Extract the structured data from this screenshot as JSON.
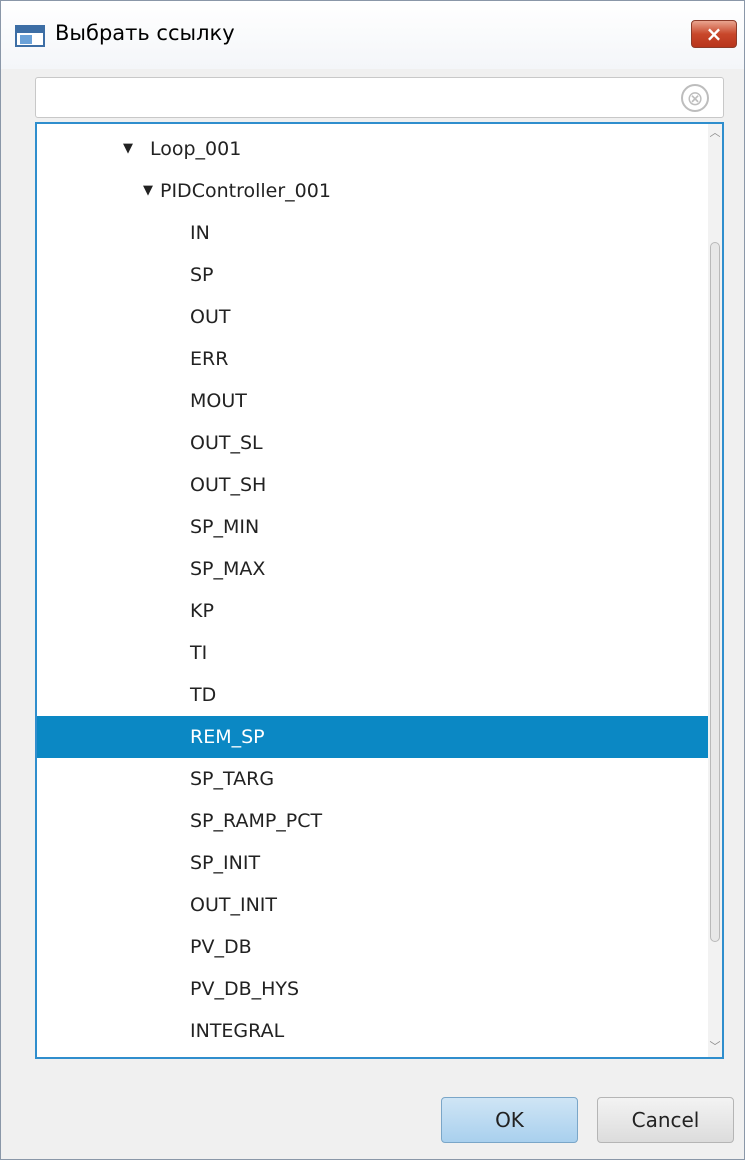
{
  "window": {
    "title": "Выбрать ссылку",
    "close_label": "×"
  },
  "search": {
    "value": "",
    "placeholder": "",
    "clear_icon": "⊗"
  },
  "tree": {
    "loop": {
      "label": "Loop_001",
      "expanded": true
    },
    "controller": {
      "label": "PIDController_001",
      "expanded": true
    },
    "items": [
      {
        "label": "IN"
      },
      {
        "label": "SP"
      },
      {
        "label": "OUT"
      },
      {
        "label": "ERR"
      },
      {
        "label": "MOUT"
      },
      {
        "label": "OUT_SL"
      },
      {
        "label": "OUT_SH"
      },
      {
        "label": "SP_MIN"
      },
      {
        "label": "SP_MAX"
      },
      {
        "label": "KP"
      },
      {
        "label": "TI"
      },
      {
        "label": "TD"
      },
      {
        "label": "REM_SP",
        "selected": true
      },
      {
        "label": "SP_TARG"
      },
      {
        "label": "SP_RAMP_PCT"
      },
      {
        "label": "SP_INIT"
      },
      {
        "label": "OUT_INIT"
      },
      {
        "label": "PV_DB"
      },
      {
        "label": "PV_DB_HYS"
      },
      {
        "label": "INTEGRAL"
      }
    ]
  },
  "buttons": {
    "ok_label": "OK",
    "cancel_label": "Cancel"
  },
  "colors": {
    "selection": "#0b88c4",
    "tree_border": "#2f8ecd",
    "close_button": "#c8472b"
  }
}
